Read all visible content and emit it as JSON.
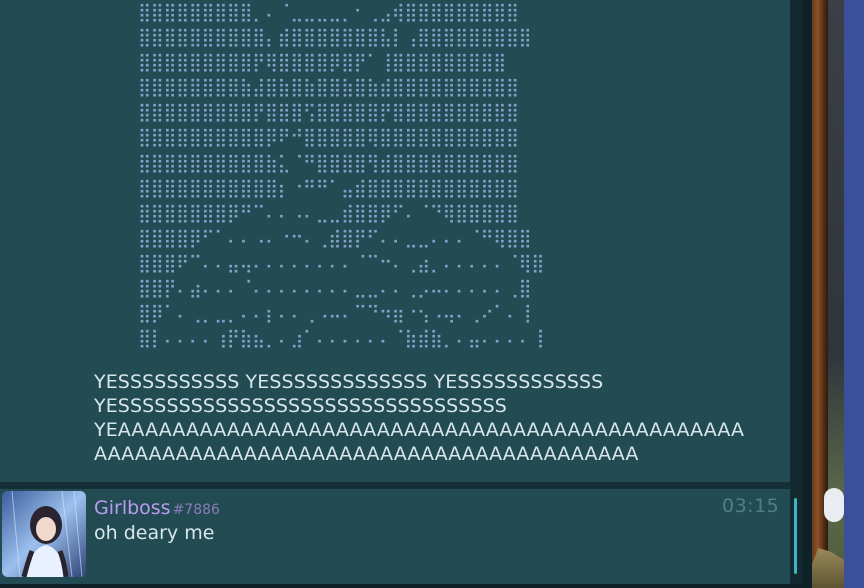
{
  "ascii_art": {
    "lines": [
      "⣿⣿⣿⣿⣿⣿⣿⣿⣿⡀⠄⠈⣀⣀⣀⣀⡀⠂⢀⣠⢾⣿⣿⣿⣿⣿⣿⣿⣿⣿",
      "⣿⣿⣿⣿⣿⣿⣿⣿⣿⣿⡄⣾⣿⣿⣿⣿⣿⣿⣿⣧⡇⢠⣿⣿⣿⣿⣿⣿⣿⣿⣿",
      "⣿⣿⣿⣿⣿⣿⣿⣿⣿⡟⢿⣿⣿⣿⣿⡿⣿⡟⠁⢸⣿⣿⣿⣿⣿⣿⣿⣿⣿",
      "⣿⣿⣿⣿⣿⣿⣿⣿⣷⣼⣿⣷⣿⣷⣿⣿⣷⣿⣷⣾⣿⣿⣿⣿⣿⣿⣿⣿⣿⣿",
      "⣿⣿⣿⣿⣿⣿⣿⣿⣿⡟⣿⣿⣿⢫⣿⣿⣿⣿⣿⡟⣿⣿⣿⣿⣿⣿⣿⣿⣿⣿",
      "⣿⣿⣿⣿⣿⣿⣿⣿⣿⣿⡿⠟⠚⣿⣿⣿⣿⣿⢿⣿⣿⣿⣿⣿⣿⣿⣿⣿⣿⣿",
      "⣿⣿⣿⣿⣿⣿⣿⣿⣿⣿⣷⣅⠈⠛⣿⣿⣿⣿⢻⣾⣿⣿⣿⣿⣿⣿⣿⣿⣿⣿",
      "⣿⣿⣿⣿⣿⣿⣿⣿⣿⣿⣿⡆⠐⠛⠛⠁⣤⣾⣿⣿⣿⣿⣿⣿⣿⣿⣿⣿⣿⣿",
      "⣿⣿⣿⣿⣿⣿⣿⡿⠛⠉⠄⠄⠠⠄⣀⣀⣾⣿⣿⡿⠋⠄⠈⠙⢿⣿⣿⣿⣿⣿",
      "⣿⣿⣿⣿⡿⠋⠁⠄⠄⠠⠄⠐⠒⠄⢀⣾⣿⡟⠋⠄⠄⣀⣀⠄⠄⠄⠈⠛⢿⣿⣿",
      "⣿⣿⣿⠟⠉⠄⠄⣤⢤⠄⠄⠄⠄⠄⠄⠄⠄⠈⠉⠒⠄⢀⣴⡀⠄⠄⠄⠄⠄⠈⢿⣿",
      "⣿⣿⡟⠄⣴⠄⠄⠄⠈⠄⠄⠄⠄⠄⠄⠄⠄⣀⣀⠄⠄⢀⡠⠤⠄⠄⠄⠄⠄⢀⣿",
      "⣿⡿⠁⠄⢀⡀⣀⡀⠄⠄⡆⠄⠄⢀⠠⠤⠄⠉⠙⠲⣶⠐⢢⠠⢤⠄⢀⠔⠁⠄⢸",
      "⣿⡇⠄⠄⠄⠄⢰⡟⣷⣦⡀⠄⣰⠁⠄⠄⠄⠄⠄⠄⠈⣷⣾⣷⡀⠄⣤⠄⠄⠄⠄⢸"
    ]
  },
  "message_top": {
    "shout_lines": [
      "YESSSSSSSSSS YESSSSSSSSSSSSS YESSSSSSSSSSSS",
      "YESSSSSSSSSSSSSSSSSSSSSSSSSSSSSSSS",
      "YEAAAAAAAAAAAAAAAAAAAAAAAAAAAAAAAAAAAAAAAAAAAAAA",
      "AAAAAAAAAAAAAAAAAAAAAAAAAAAAAAAAAAAAAAAA"
    ]
  },
  "message_bottom": {
    "username": "Girlboss",
    "discriminator": "#7886",
    "text": "oh deary me",
    "timestamp": "03:15",
    "avatar_icon": "avatar-portrait-icon"
  },
  "colors": {
    "background": "#234b53",
    "username": "#b99bf0",
    "text": "#d8e6ec",
    "timestamp": "#4d7f8c",
    "ascii_art": "#8fa9d6",
    "scroll_thumb": "#3fb6c4"
  }
}
